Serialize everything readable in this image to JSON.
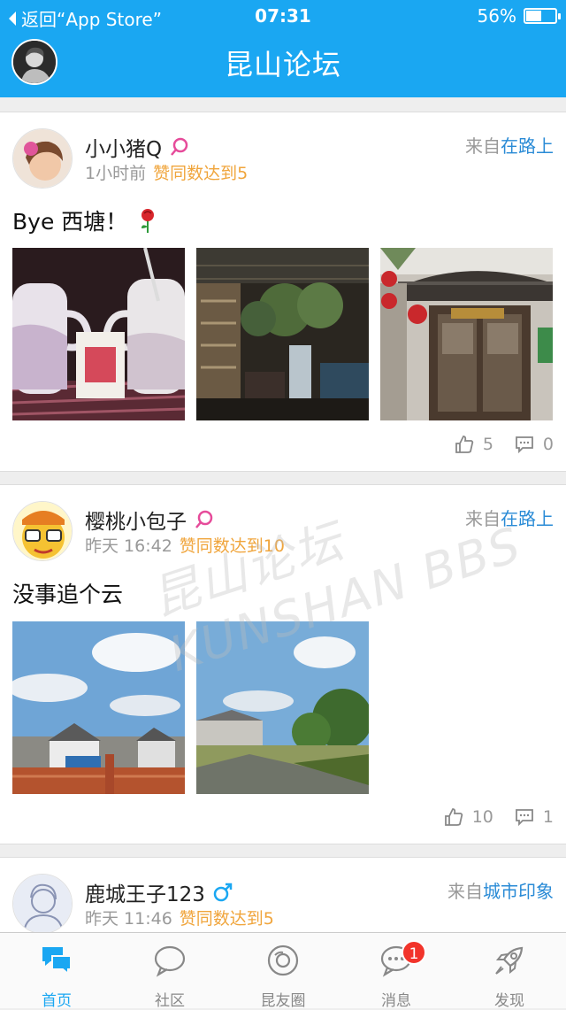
{
  "status_bar": {
    "back_label": "返回“App Store”",
    "time": "07:31",
    "battery": "56%",
    "battery_level": 0.56
  },
  "header": {
    "title": "昆山论坛"
  },
  "posts": [
    {
      "author": "小小猪Q",
      "time": "1小时前",
      "praise": "赞同数达到5",
      "source_prefix": "来自",
      "source_forum": "在路上",
      "content": "Bye 西塘！",
      "likes": "5",
      "comments": "0"
    },
    {
      "author": "樱桃小包子",
      "time": "昨天 16:42",
      "praise": "赞同数达到10",
      "source_prefix": "来自",
      "source_forum": "在路上",
      "content": "没事追个云",
      "likes": "10",
      "comments": "1"
    },
    {
      "author": "鹿城王子123",
      "time": "昨天 11:46",
      "praise": "赞同数达到5",
      "source_prefix": "来自",
      "source_forum": "城市印象"
    }
  ],
  "watermark": "昆山论坛 KUNSHAN BBS",
  "tabs": [
    {
      "label": "首页",
      "icon": "home-chat-icon"
    },
    {
      "label": "社区",
      "icon": "chat-bubble-icon"
    },
    {
      "label": "昆友圈",
      "icon": "camera-lens-icon"
    },
    {
      "label": "消息",
      "icon": "message-dots-icon",
      "badge": "1"
    },
    {
      "label": "发现",
      "icon": "rocket-icon"
    }
  ],
  "colors": {
    "brand": "#1aa7f2",
    "praise": "#f0a53c",
    "forum_link": "#2a8bd6",
    "badge": "#f2342b",
    "female": "#e64b9a",
    "male": "#1aa7f2"
  }
}
